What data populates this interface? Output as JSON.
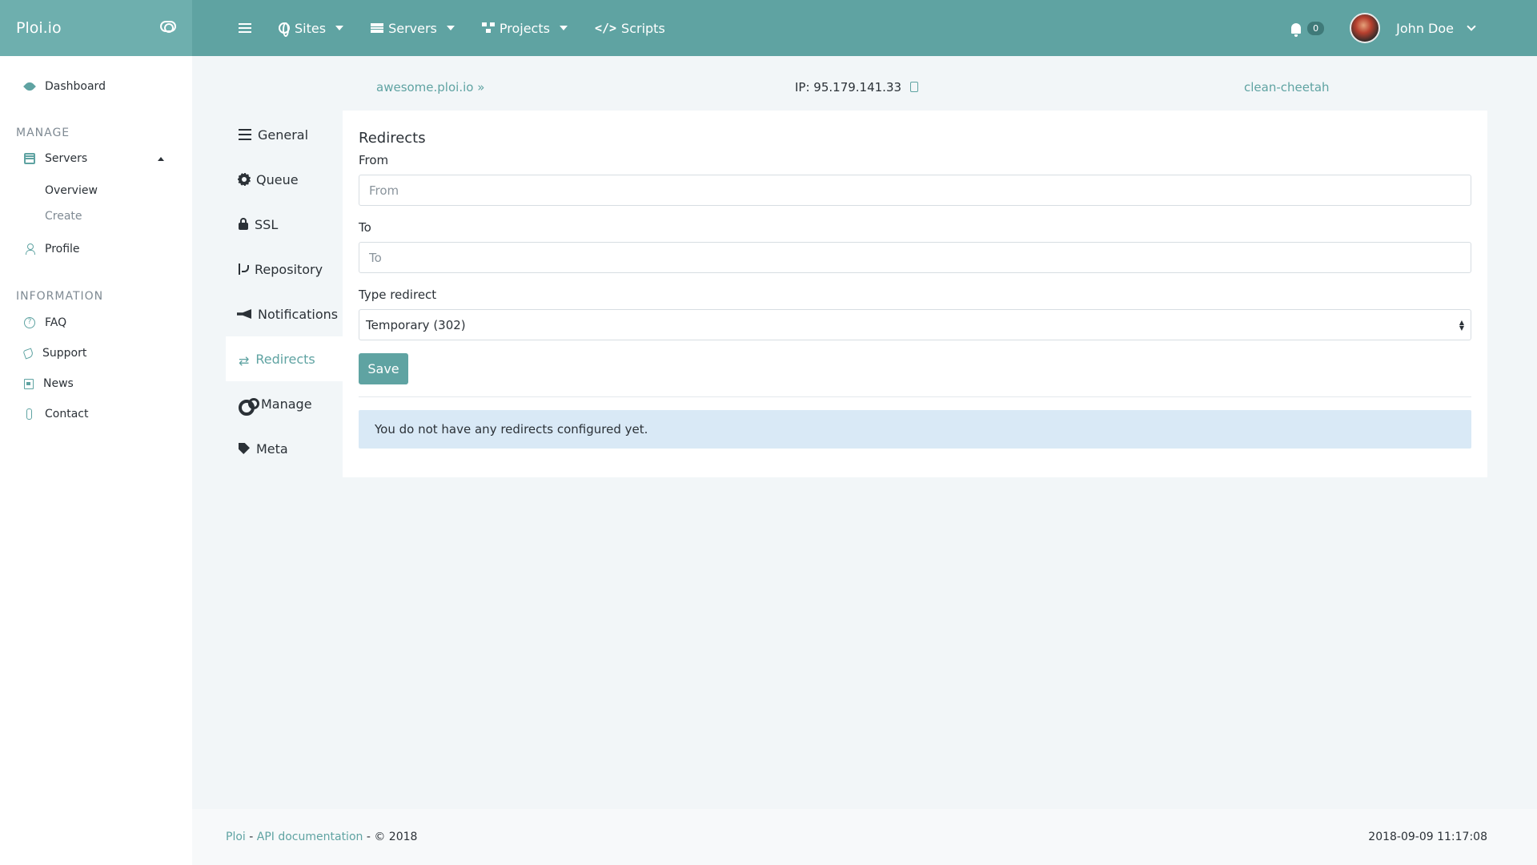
{
  "brand": "Ploi.io",
  "topnav": {
    "sites": "Sites",
    "servers": "Servers",
    "projects": "Projects",
    "scripts": "Scripts",
    "notifications_count": "0",
    "user_name": "John Doe"
  },
  "sidebar": {
    "dashboard": "Dashboard",
    "manage_header": "MANAGE",
    "servers": "Servers",
    "overview": "Overview",
    "create": "Create",
    "profile": "Profile",
    "information_header": "INFORMATION",
    "faq": "FAQ",
    "support": "Support",
    "news": "News",
    "contact": "Contact"
  },
  "site": {
    "domain": "awesome.ploi.io",
    "ip": "IP: 95.179.141.33",
    "server_name": "clean-cheetah"
  },
  "tabs": {
    "general": "General",
    "queue": "Queue",
    "ssl": "SSL",
    "repository": "Repository",
    "notifications": "Notifications",
    "redirects": "Redirects",
    "manage": "Manage",
    "meta": "Meta"
  },
  "redirects": {
    "title": "Redirects",
    "from_label": "From",
    "from_placeholder": "From",
    "to_label": "To",
    "to_placeholder": "To",
    "type_label": "Type redirect",
    "type_value": "Temporary (302)",
    "save": "Save",
    "empty_message": "You do not have any redirects configured yet."
  },
  "footer": {
    "ploi": "Ploi",
    "sep1": " - ",
    "api_docs": "API documentation",
    "copyright": " - © 2018",
    "timestamp": "2018-09-09 11:17:08"
  },
  "colors": {
    "accent": "#5fa3a2",
    "brand_bg": "#6eafae",
    "alert_bg": "#d9e9f6"
  }
}
